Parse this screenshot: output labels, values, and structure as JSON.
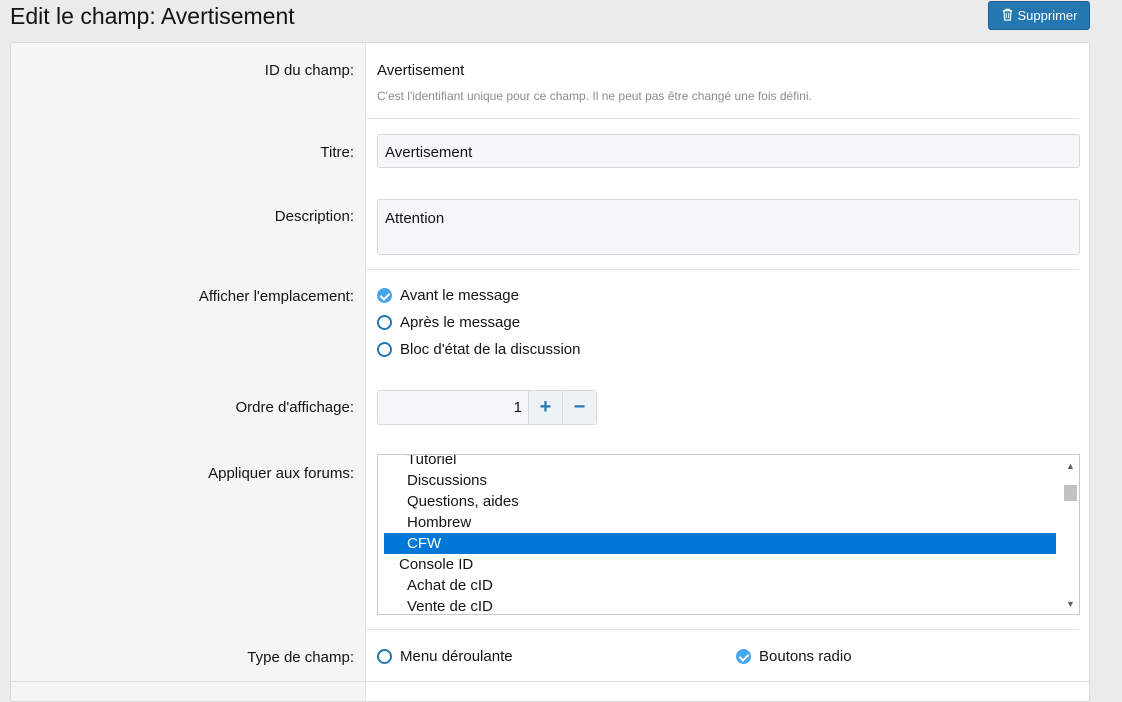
{
  "header": {
    "title": "Edit le champ: Avertisement",
    "delete_label": "Supprimer"
  },
  "fields": {
    "field_id": {
      "label": "ID du champ:",
      "value": "Avertisement",
      "hint": "C'est l'identifiant unique pour ce champ. Il ne peut pas être changé une fois défini."
    },
    "title": {
      "label": "Titre:",
      "value": "Avertisement"
    },
    "description": {
      "label": "Description:",
      "value": "Attention"
    },
    "display_location": {
      "label": "Afficher l'emplacement:",
      "options": [
        "Avant le message",
        "Après le message",
        "Bloc d'état de la discussion"
      ],
      "selected_index": 0
    },
    "display_order": {
      "label": "Ordre d'affichage:",
      "value": "1",
      "plus": "+",
      "minus": "−"
    },
    "forums": {
      "label": "Appliquer aux forums:",
      "items": [
        "Tutoriel",
        "Discussions",
        "Questions, aides",
        "Hombrew",
        "CFW",
        "Console ID",
        "Achat de cID",
        "Vente de cID"
      ],
      "selected": "CFW"
    },
    "field_type": {
      "label": "Type de champ:",
      "options": [
        "Menu déroulante",
        "Boutons radio"
      ],
      "selected_index": 1
    }
  },
  "colors": {
    "accent": "#2577b1",
    "radio_checked": "#47a7eb",
    "list_selected": "#0078d7"
  }
}
